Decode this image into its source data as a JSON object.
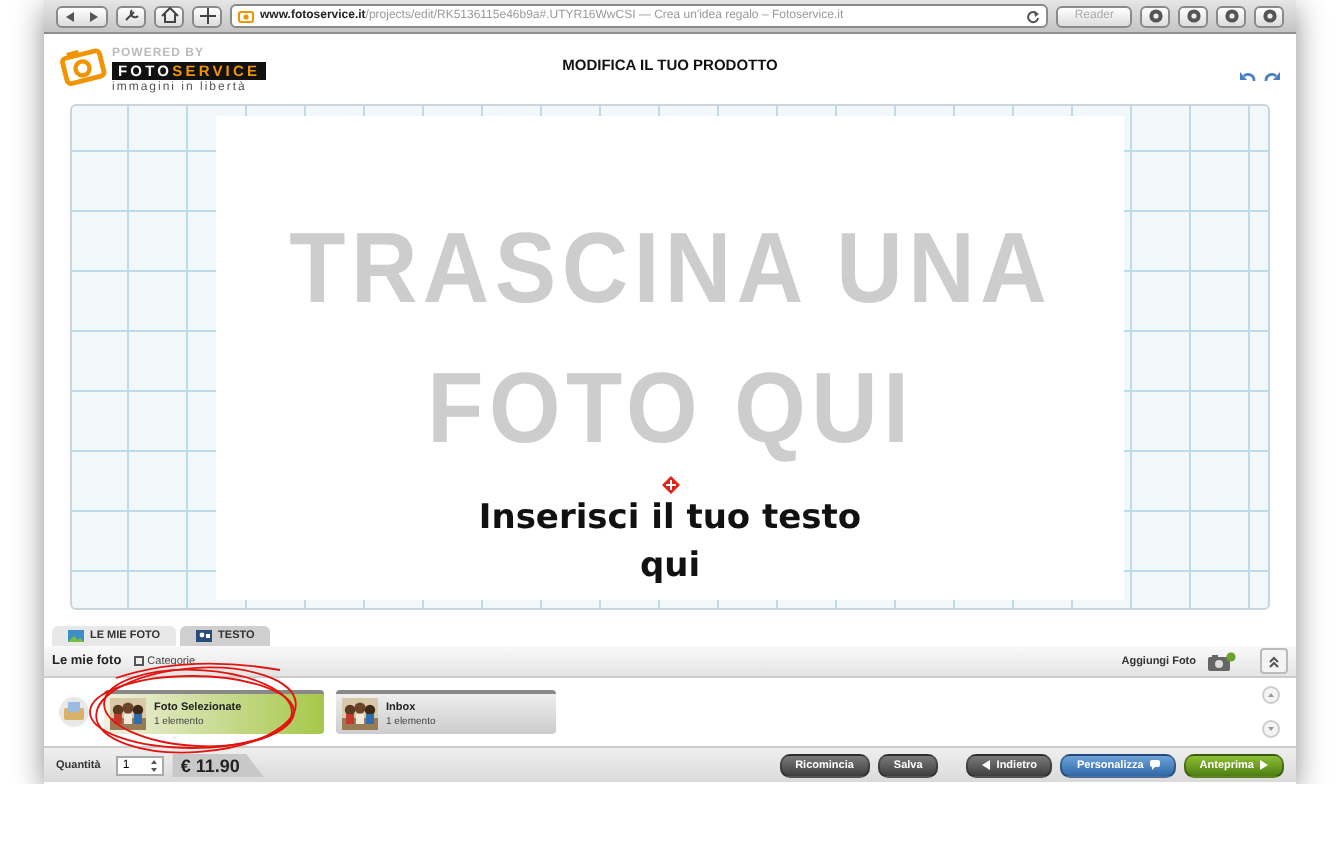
{
  "browser": {
    "url_host": "www.fotoservice.it",
    "url_path": "/projects/edit/RK5136115e46b9a#.UTYR16WwCSI",
    "page_title": " — Crea un'idea regalo – Fotoservice.it",
    "reader": "Reader"
  },
  "logo": {
    "powered": "POWERED BY",
    "brand_1": "FOTO",
    "brand_2": "SERVICE",
    "tagline": "immagini in libertà"
  },
  "title": "MODIFICA IL TUO PRODOTTO",
  "canvas": {
    "drop_hint": [
      "TRASCINA UNA",
      "FOTO QUI"
    ],
    "text_hint": [
      "Inserisci il tuo testo",
      "qui"
    ]
  },
  "tabs": [
    {
      "label": "LE MIE FOTO",
      "selected": true
    },
    {
      "label": "TESTO",
      "selected": false
    }
  ],
  "photos_bar": {
    "title": "Le mie foto",
    "categories": "Categorie",
    "add_photo": "Aggiungi Foto"
  },
  "albums": [
    {
      "name": "Foto Selezionate",
      "count": "1 elemento",
      "selected": true
    },
    {
      "name": "Inbox",
      "count": "1 elemento",
      "selected": false
    }
  ],
  "order": {
    "quantity_label": "Quantità",
    "quantity": "1",
    "price": "€ 11.90"
  },
  "buttons": [
    {
      "label": "Ricomincia",
      "kind": "plain"
    },
    {
      "label": "Salva",
      "kind": "plain"
    },
    {
      "label": "Indietro",
      "kind": "back"
    },
    {
      "label": "Personalizza",
      "kind": "customize"
    },
    {
      "label": "Anteprima",
      "kind": "next"
    }
  ]
}
